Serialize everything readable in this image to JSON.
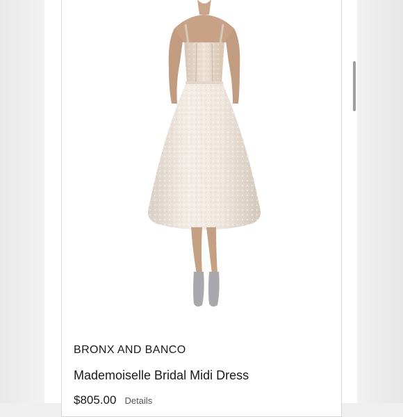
{
  "product": {
    "brand": "BRONX AND BANCO",
    "name": "Mademoiselle Bridal Midi Dress",
    "price": "$805.00",
    "details_label": "Details",
    "image_icon": "product-photo-dress"
  },
  "colors": {
    "card_border": "#d6d6d6",
    "text": "#1a1a1a",
    "dress": "#ece2da",
    "background": "#efefef"
  }
}
